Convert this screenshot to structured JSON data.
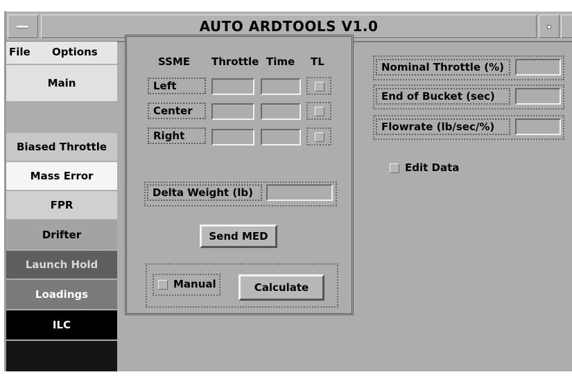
{
  "window": {
    "title": "AUTO ARDTOOLS V1.0"
  },
  "menu": {
    "file": "File",
    "options": "Options"
  },
  "sidebar": {
    "items": [
      {
        "label": "Main",
        "bg": "#e1e1e1",
        "fg": "#000000"
      },
      {
        "label": "",
        "bg": "#adadad",
        "fg": "#000000"
      },
      {
        "label": "Biased Throttle",
        "bg": "#c8c8c8",
        "fg": "#000000"
      },
      {
        "label": "Mass Error",
        "bg": "#f5f5f5",
        "fg": "#000000"
      },
      {
        "label": "FPR",
        "bg": "#d0d0d0",
        "fg": "#000000"
      },
      {
        "label": "Drifter",
        "bg": "#a3a3a3",
        "fg": "#000000"
      },
      {
        "label": "Launch Hold",
        "bg": "#5e5e5e",
        "fg": "#d8d8d8"
      },
      {
        "label": "Loadings",
        "bg": "#7a7a7a",
        "fg": "#ffffff"
      },
      {
        "label": "ILC",
        "bg": "#000000",
        "fg": "#ffffff"
      },
      {
        "label": "",
        "bg": "#141414",
        "fg": "#ffffff"
      }
    ]
  },
  "table": {
    "headers": {
      "ssme": "SSME",
      "throttle": "Throttle",
      "time": "Time",
      "tl": "TL"
    },
    "rows": [
      {
        "label": "Left",
        "throttle": "",
        "time": ""
      },
      {
        "label": "Center",
        "throttle": "",
        "time": ""
      },
      {
        "label": "Right",
        "throttle": "",
        "time": ""
      }
    ]
  },
  "delta_weight": {
    "label": "Delta Weight (lb)",
    "value": ""
  },
  "send_med": "Send MED",
  "manual": {
    "label": "Manual",
    "checked": false
  },
  "calculate": "Calculate",
  "params": {
    "nominal_throttle": {
      "label": "Nominal Throttle (%)",
      "value": ""
    },
    "end_of_bucket": {
      "label": "End of Bucket (sec)",
      "value": ""
    },
    "flowrate": {
      "label": "Flowrate (lb/sec/%)",
      "value": ""
    }
  },
  "edit_data": {
    "label": "Edit Data",
    "checked": false
  }
}
